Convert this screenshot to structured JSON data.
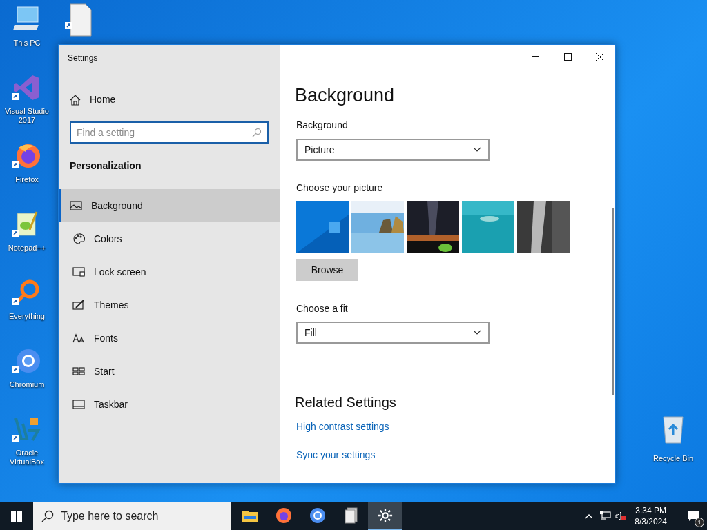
{
  "desktop_icons": [
    {
      "label": "This PC",
      "kind": "computer"
    },
    {
      "label": "Visual Studio 2017",
      "kind": "studio"
    },
    {
      "label": "Firefox",
      "kind": "firefox"
    },
    {
      "label": "Notepad++",
      "kind": "notepad"
    },
    {
      "label": "Everything",
      "kind": "everything"
    },
    {
      "label": "Chromium",
      "kind": "chromium"
    },
    {
      "label": "Oracle VirtualBox",
      "kind": "virtualbox"
    }
  ],
  "partial_icon": {
    "kind": "document"
  },
  "recycle_bin": {
    "label": "Recycle Bin"
  },
  "window": {
    "title": "Settings",
    "sidebar": {
      "home": "Home",
      "search": {
        "placeholder": "Find a setting"
      },
      "section": "Personalization",
      "items": [
        {
          "label": "Background",
          "kind": "picture",
          "selected": true
        },
        {
          "label": "Colors",
          "kind": "palette",
          "selected": false
        },
        {
          "label": "Lock screen",
          "kind": "lock",
          "selected": false
        },
        {
          "label": "Themes",
          "kind": "brush",
          "selected": false
        },
        {
          "label": "Fonts",
          "kind": "fonts",
          "selected": false
        },
        {
          "label": "Start",
          "kind": "start",
          "selected": false
        },
        {
          "label": "Taskbar",
          "kind": "taskbar",
          "selected": false
        }
      ]
    },
    "content": {
      "heading": "Background",
      "background_label": "Background",
      "background_value": "Picture",
      "pictures_label": "Choose your picture",
      "browse": "Browse",
      "fit_label": "Choose a fit",
      "fit_value": "Fill",
      "related_heading": "Related Settings",
      "links": [
        "High contrast settings",
        "Sync your settings"
      ]
    }
  },
  "taskbar": {
    "search": {
      "placeholder": "Type here to search"
    },
    "apps": [
      {
        "kind": "explorer",
        "selected": false
      },
      {
        "kind": "firefox",
        "selected": false
      },
      {
        "kind": "chromium",
        "selected": false
      },
      {
        "kind": "app",
        "selected": false
      },
      {
        "kind": "settings",
        "selected": true
      }
    ],
    "time": "3:34 PM",
    "date": "8/3/2024",
    "notifications": "1"
  }
}
